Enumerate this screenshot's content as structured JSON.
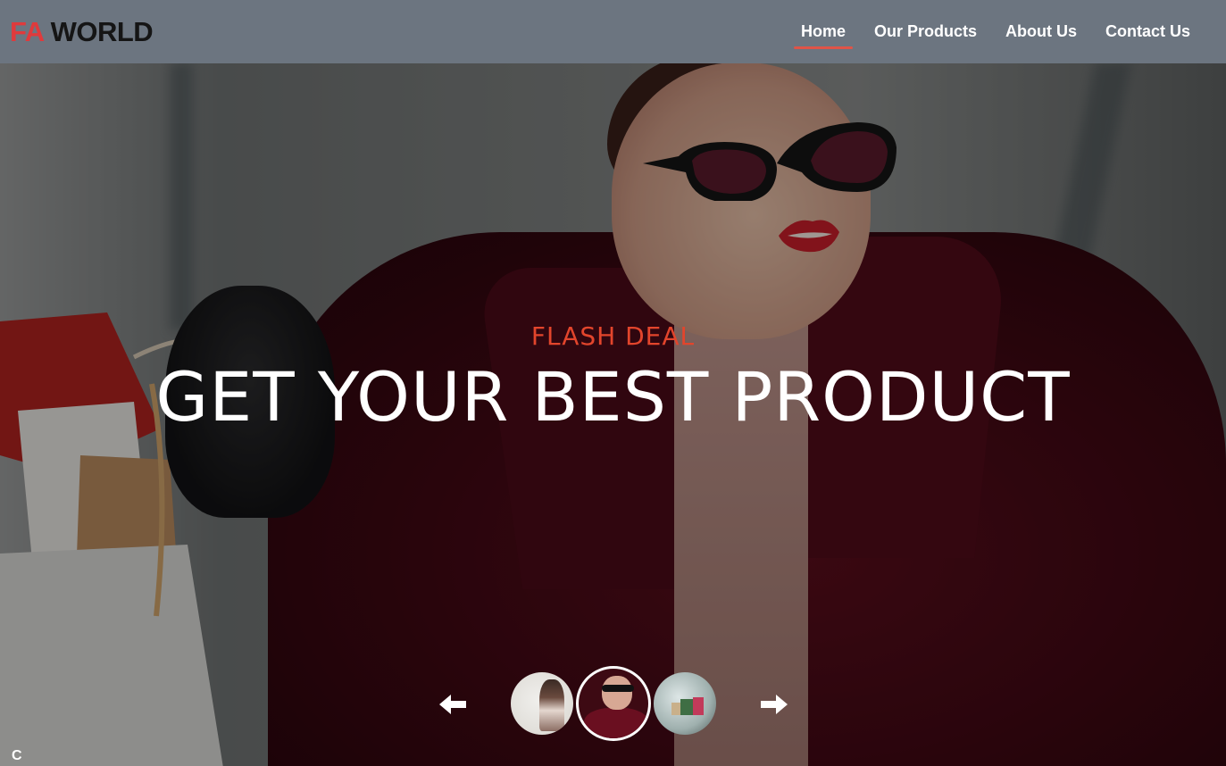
{
  "brand": {
    "part1": "FA",
    "part2": " WORLD"
  },
  "nav": {
    "items": [
      {
        "label": "Home",
        "active": true
      },
      {
        "label": "Our Products",
        "active": false
      },
      {
        "label": "About Us",
        "active": false
      },
      {
        "label": "Contact Us",
        "active": false
      }
    ]
  },
  "hero": {
    "subtitle": "FLASH DEAL",
    "title": "GET YOUR BEST PRODUCT",
    "background_image": "woman-with-sunglasses-and-shopping-bags"
  },
  "carousel": {
    "prev_icon": "arrow-left-icon",
    "next_icon": "arrow-right-icon",
    "active_index": 1,
    "thumbnails": [
      {
        "image": "woman-with-curly-hair"
      },
      {
        "image": "woman-with-sunglasses-red-coat"
      },
      {
        "image": "shopping-bags-in-mall"
      }
    ]
  },
  "corner_text": "C",
  "colors": {
    "navbar_bg": "#6c7580",
    "brand_accent": "#e03a3c",
    "subtitle": "#e2452c",
    "active_underline": "#e05448"
  }
}
